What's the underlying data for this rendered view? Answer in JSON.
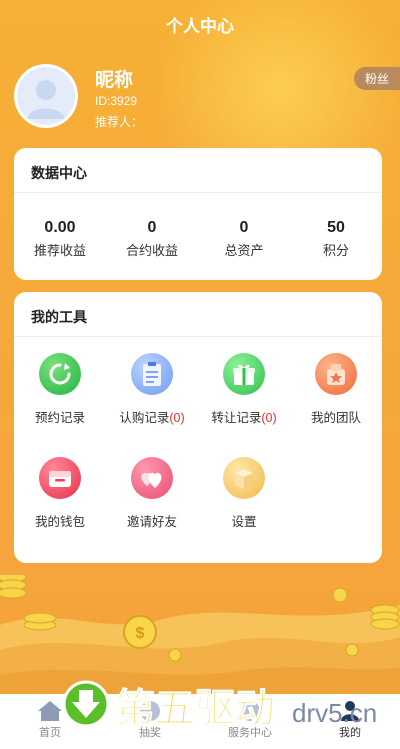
{
  "header": {
    "title": "个人中心"
  },
  "profile": {
    "nickname": "昵称",
    "id_text": "ID:3929",
    "referrer_text": "推荐人：",
    "fans_label": "粉丝"
  },
  "data_center": {
    "title": "数据中心",
    "stats": [
      {
        "value": "0.00",
        "label": "推荐收益"
      },
      {
        "value": "0",
        "label": "合约收益"
      },
      {
        "value": "0",
        "label": "总资产"
      },
      {
        "value": "50",
        "label": "积分"
      }
    ]
  },
  "tools": {
    "title": "我的工具",
    "items": [
      {
        "label": "预约记录",
        "count": "",
        "icon": "refresh-icon",
        "color": "#2fbf4b"
      },
      {
        "label": "认购记录",
        "count": "(0)",
        "icon": "clipboard-icon",
        "color": "#5b8cf0"
      },
      {
        "label": "转让记录",
        "count": "(0)",
        "icon": "gift-icon",
        "color": "#3cc95a"
      },
      {
        "label": "我的团队",
        "count": "",
        "icon": "team-badge-icon",
        "color": "#f07a45"
      },
      {
        "label": "我的钱包",
        "count": "",
        "icon": "wallet-icon",
        "color": "#ee3d55"
      },
      {
        "label": "邀请好友",
        "count": "",
        "icon": "hearts-icon",
        "color": "#f05a7a"
      },
      {
        "label": "设置",
        "count": "",
        "icon": "box-icon",
        "color": "#f6c255"
      }
    ]
  },
  "tabbar": {
    "items": [
      {
        "label": "首页",
        "icon": "home-icon",
        "active": false
      },
      {
        "label": "抽奖",
        "icon": "prize-icon",
        "active": false
      },
      {
        "label": "服务中心",
        "icon": "service-icon",
        "active": false
      },
      {
        "label": "我的",
        "icon": "user-icon",
        "active": true
      }
    ]
  },
  "watermark": {
    "text_cn": "第五驱动",
    "text_en": "drv5.cn"
  },
  "colors": {
    "primary_bg": "#f5a93a",
    "count_red": "#e0302c",
    "fans_badge": "#b88a5e"
  }
}
